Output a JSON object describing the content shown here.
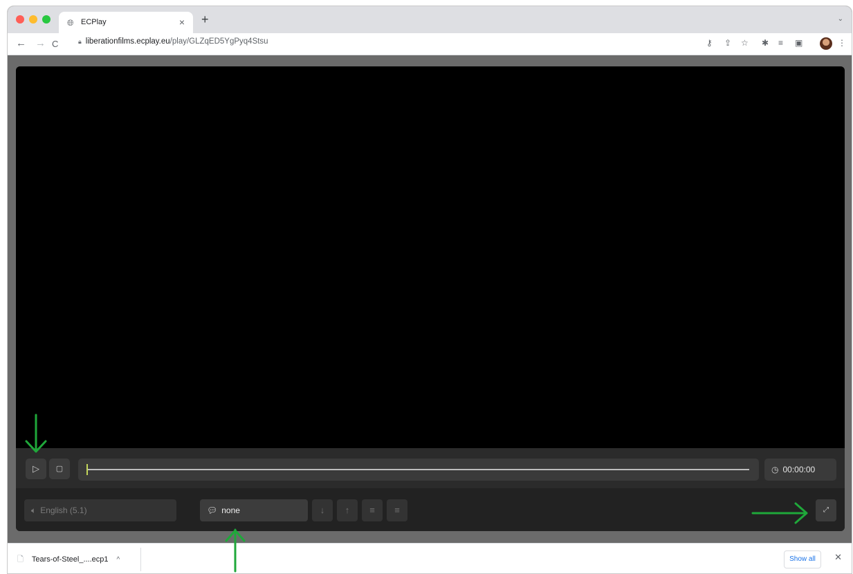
{
  "browser": {
    "tab_title": "ECPlay",
    "tab_close": "×",
    "new_tab": "+",
    "tab_menu": "⌄",
    "url_host": "liberationfilms.ecplay.eu",
    "url_path": "/play/GLZqED5YgPyq4Stsu",
    "traffic_colors": [
      "#ff5f57",
      "#febc2e",
      "#28c840"
    ]
  },
  "player": {
    "time": "00:00:00",
    "progress_fraction": 0,
    "audio_track": "English (5.1)",
    "subtitle_track": "none",
    "accent_color": "#c3d65a"
  },
  "downloads": {
    "file_name": "Tears-of-Steel_....ecp1",
    "show_all": "Show all"
  },
  "annotations": {
    "arrow_color": "#1fa83a"
  }
}
